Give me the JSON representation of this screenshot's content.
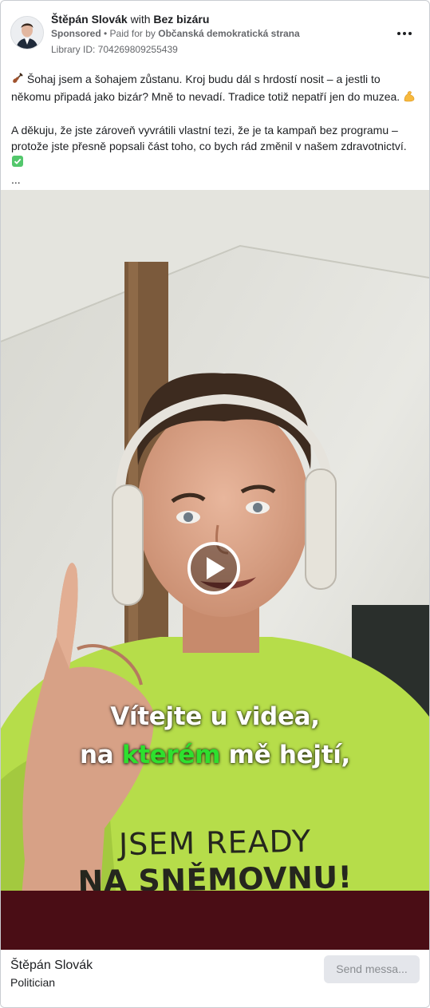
{
  "post": {
    "author": "Štěpán Slovák",
    "with_word": "with",
    "coauthor": "Bez bizáru",
    "sponsored": "Sponsored",
    "separator": " • ",
    "paid_for_prefix": "Paid for by ",
    "payer": "Občanská demokratická strana",
    "library_id": "Library ID: 704269809255439",
    "more_icon": "more-horizontal-icon"
  },
  "body": {
    "p1_text": "Šohaj jsem a šohajem zůstanu. Kroj budu dál s hrdostí nosit – a jestli to někomu připadá jako bizár? Mně to nevadí. Tradice totiž nepatří jen do muzea.",
    "p1_lead_icon": "violin-icon",
    "p1_trail_icon": "flexed-biceps-icon",
    "p2_text": "A děkuju, že jste zároveň vyvrátili vlastní tezi, že je ta kampaň bez programu – protože jste přesně popsali část toho, co bych rád změnil v našem zdravotnictví.",
    "p2_trail_icon": "check-mark-button-icon",
    "ellipsis": "..."
  },
  "video": {
    "subtitle_line1": "Vítejte u videa,",
    "subtitle_line2_pre": "na ",
    "subtitle_line2_highlight": "kterém",
    "subtitle_line2_post": " mě hejtí,",
    "shirt_line1": "JSEM READY",
    "shirt_line2": "NA SNĚMOVNU!",
    "play_icon": "play-icon"
  },
  "footer": {
    "page_name": "Štěpán Slovák",
    "page_category": "Politician",
    "send_button": "Send messa..."
  },
  "colors": {
    "highlight_green": "#2ee02e",
    "shirt_green": "#b6dd4a",
    "controls_bar": "#4a0d15",
    "muted_text": "#65676b",
    "button_bg": "#e4e6eb"
  }
}
